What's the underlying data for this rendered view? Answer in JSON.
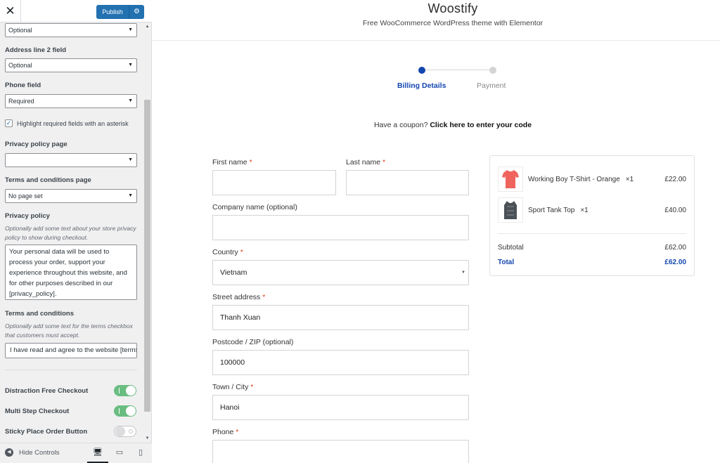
{
  "customizer": {
    "close_symbol": "✕",
    "publish_label": "Publish",
    "first_select_value": "Optional",
    "address2": {
      "label": "Address line 2 field",
      "value": "Optional"
    },
    "phone": {
      "label": "Phone field",
      "value": "Required"
    },
    "highlight_required": {
      "label": "Highlight required fields with an asterisk",
      "checked": true
    },
    "privacy_page": {
      "label": "Privacy policy page",
      "value": ""
    },
    "terms_page": {
      "label": "Terms and conditions page",
      "value": "No page set"
    },
    "privacy_policy": {
      "label": "Privacy policy",
      "description": "Optionally add some text about your store privacy policy to show during checkout.",
      "text": "Your personal data will be used to process your order, support your experience throughout this website, and for other purposes described in our [privacy_policy]."
    },
    "terms_conditions": {
      "label": "Terms and conditions",
      "description": "Optionally add some text for the terms checkbox that customers must accept.",
      "text": "I have read and agree to the website [terms]"
    },
    "toggles": {
      "distraction_free": {
        "label": "Distraction Free Checkout",
        "on": true
      },
      "multi_step": {
        "label": "Multi Step Checkout",
        "on": true
      },
      "sticky_order": {
        "label": "Sticky Place Order Button",
        "on": false
      }
    },
    "footer": {
      "hide_controls_label": "Hide Controls"
    }
  },
  "site": {
    "title": "Woostify",
    "tagline": "Free WooCommerce WordPress theme with Elementor"
  },
  "steps": [
    {
      "label": "Billing Details",
      "active": true
    },
    {
      "label": "Payment",
      "active": false
    }
  ],
  "coupon": {
    "text": "Have a coupon?",
    "link": "Click here to enter your code"
  },
  "billing": {
    "first_name": {
      "label": "First name",
      "value": ""
    },
    "last_name": {
      "label": "Last name",
      "value": ""
    },
    "company": {
      "label": "Company name (optional)",
      "value": ""
    },
    "country": {
      "label": "Country",
      "value": "Vietnam"
    },
    "street": {
      "label": "Street address",
      "value": "Thanh Xuan"
    },
    "postcode": {
      "label": "Postcode / ZIP (optional)",
      "value": "100000"
    },
    "city": {
      "label": "Town / City",
      "value": "Hanoi"
    },
    "phone": {
      "label": "Phone",
      "value": ""
    },
    "required_marker": "*"
  },
  "order": {
    "items": [
      {
        "name": "Working Boy T-Shirt - Orange",
        "qty": "×1",
        "price": "£22.00"
      },
      {
        "name": "Sport Tank Top",
        "qty": "×1",
        "price": "£40.00"
      }
    ],
    "subtotal_label": "Subtotal",
    "subtotal": "£62.00",
    "total_label": "Total",
    "total": "£62.00"
  },
  "colors": {
    "accent": "#1346af",
    "publish": "#2271b1",
    "toggle_on": "#6abd80",
    "required": "#e2401c",
    "shirt": "#f0645e",
    "tank": "#4a5157"
  }
}
